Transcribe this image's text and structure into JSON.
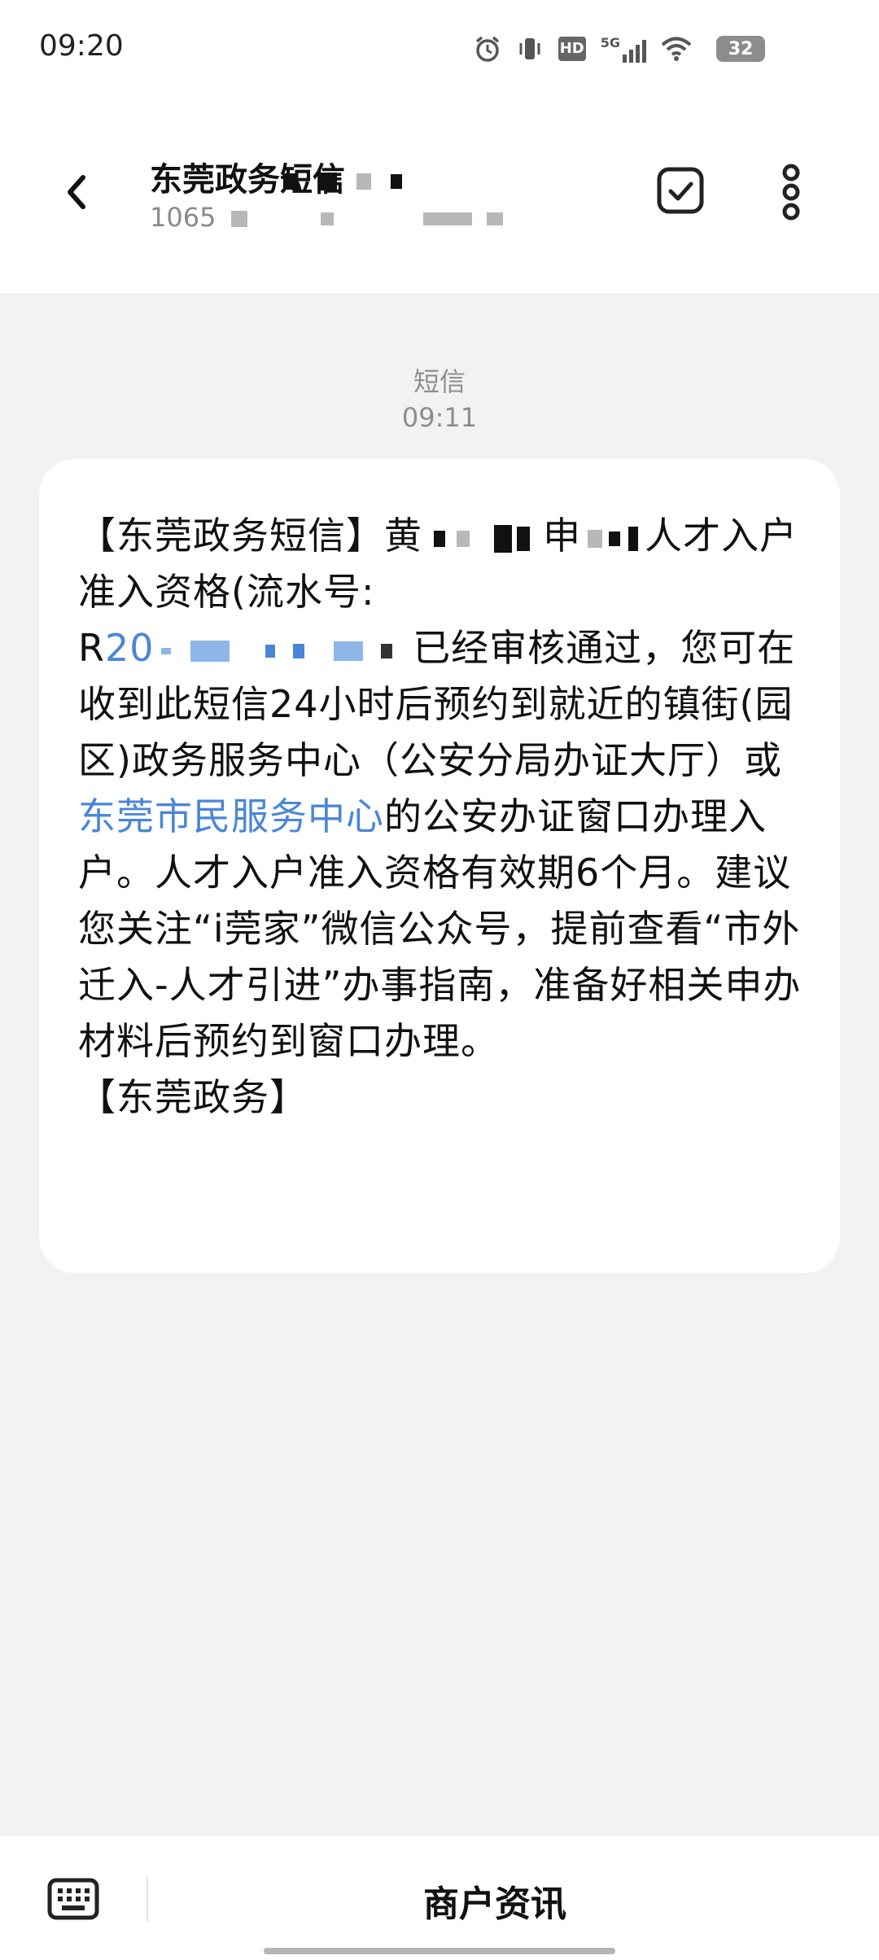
{
  "status_bar": {
    "time": "09:20",
    "icons": [
      "alarm-icon",
      "vibrate-icon",
      "hd-icon",
      "5g-signal-icon",
      "wifi-icon"
    ],
    "hd_label": "HD",
    "network_label": "5G",
    "battery": "32"
  },
  "header": {
    "sender_name": "东莞政务短信",
    "sender_number_prefix": "1065",
    "back_icon": "chevron-left-icon",
    "select_icon": "checkbox-icon",
    "more_icon": "more-vertical-icon"
  },
  "conversation": {
    "message_type": "短信",
    "message_time": "09:11",
    "message": {
      "part_1": "【东莞政务短信】黄",
      "part_2": "申",
      "part_3": "人才入户准入资格(流水号:",
      "part_4": "R",
      "part_5": "20",
      "part_6": " 已经审核通过，您可在收到此短信24小时后预约到就近的镇街(园区)政务服务中心（公安分局办证大厅）或",
      "link": "东莞市民服务中心",
      "part_7": "的公安办证窗口办理入户。人才入户准入资格有效期6个月。建议您关注“i莞家”微信公众号，提前查看“市外迁入-人才引进”办事指南，准备好相关申办材料后预约到窗口办理。",
      "part_8": "【东莞政务】"
    }
  },
  "bottom_bar": {
    "keyboard_icon": "keyboard-icon",
    "merchant_label": "商户资讯"
  },
  "colors": {
    "background": "#f2f2f2",
    "bubble": "#ffffff",
    "link": "#4a86d8",
    "muted_text": "#8d8d8d"
  }
}
